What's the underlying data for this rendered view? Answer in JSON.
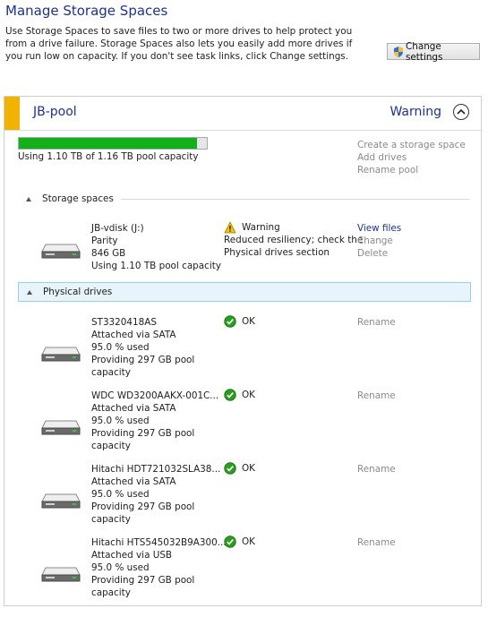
{
  "page": {
    "title": "Manage Storage Spaces",
    "description": "Use Storage Spaces to save files to two or more drives to help protect you from a drive failure. Storage Spaces also lets you easily add more drives if you run low on capacity. If you don't see task links, click Change settings.",
    "change_settings_label": "Change settings"
  },
  "pool": {
    "name": "JB-pool",
    "status": "Warning",
    "capacity_text": "Using 1.10 TB of 1.16 TB pool capacity",
    "capacity_fraction": 0.948,
    "task_links": [
      "Create a storage space",
      "Add drives",
      "Rename pool"
    ]
  },
  "storage_spaces": {
    "header": "Storage spaces",
    "items": [
      {
        "name": "JB-vdisk (J:)",
        "resiliency": "Parity",
        "size": "846 GB",
        "usage": "Using 1.10 TB pool capacity",
        "status_title": "Warning",
        "status_detail_1": "Reduced resiliency; check the",
        "status_detail_2": "Physical drives section",
        "actions": [
          "View files",
          "Change",
          "Delete"
        ]
      }
    ]
  },
  "physical_drives": {
    "header": "Physical drives",
    "items": [
      {
        "name": "ST3320418AS",
        "connection": "Attached via SATA",
        "used": "95.0 % used",
        "providing": "Providing 297 GB pool",
        "providing_2": "capacity",
        "status": "OK",
        "action": "Rename"
      },
      {
        "name": "WDC WD3200AAKX-001C...",
        "connection": "Attached via SATA",
        "used": "95.0 % used",
        "providing": "Providing 297 GB pool",
        "providing_2": "capacity",
        "status": "OK",
        "action": "Rename"
      },
      {
        "name": "Hitachi HDT721032SLA38...",
        "connection": "Attached via SATA",
        "used": "95.0 % used",
        "providing": "Providing 297 GB pool",
        "providing_2": "capacity",
        "status": "OK",
        "action": "Rename"
      },
      {
        "name": "Hitachi HTS545032B9A300...",
        "connection": "Attached via USB",
        "used": "95.0 % used",
        "providing": "Providing 297 GB pool",
        "providing_2": "capacity",
        "status": "OK",
        "action": "Rename"
      }
    ]
  },
  "colors": {
    "accent": "#f2b200",
    "progress": "#12b01a",
    "link": "#1e3287",
    "ok": "#2a9d1f",
    "warning": "#f5c400"
  },
  "icons": {
    "shield": "uac-shield-icon",
    "collapse": "chevron-up-icon",
    "drive": "hard-drive-icon",
    "ok": "check-circle-icon",
    "warning": "warning-triangle-icon"
  }
}
